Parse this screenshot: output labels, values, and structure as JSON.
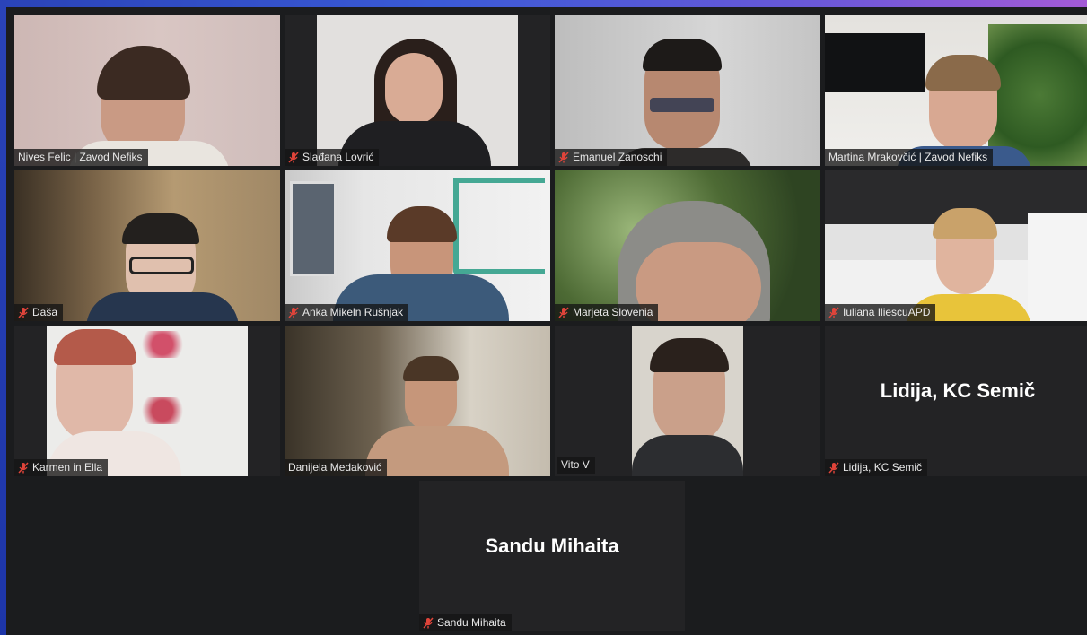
{
  "participants": [
    {
      "name": "Nives Felic | Zavod Nefiks",
      "muted": false
    },
    {
      "name": "Slađana Lovrić",
      "muted": true
    },
    {
      "name": "Emanuel Zanoschi",
      "muted": true
    },
    {
      "name": "Martina Mrakovčić | Zavod Nefiks",
      "muted": false
    },
    {
      "name": "Daša",
      "muted": true
    },
    {
      "name": "Anka Mikeln Rušnjak",
      "muted": true
    },
    {
      "name": "Marjeta Slovenia",
      "muted": true
    },
    {
      "name": "Iuliana IliescuAPD",
      "muted": true
    },
    {
      "name": "Karmen in Ella",
      "muted": true
    },
    {
      "name": "Danijela Medaković",
      "muted": false
    },
    {
      "name": "Vito V",
      "muted": false,
      "active_speaker": true
    },
    {
      "name": "Lidija, KC Semič",
      "muted": true,
      "video_off": true,
      "display_name": "Lidija, KC Semič"
    },
    {
      "name": "Sandu Mihaita",
      "muted": true,
      "video_off": true,
      "display_name": "Sandu Mihaita"
    }
  ],
  "colors": {
    "background": "#1b1c1e",
    "tile": "#232325",
    "active_speaker_border": "#c6e36a",
    "muted_icon": "#e0443a"
  },
  "icons": {
    "muted": "mic-muted-icon"
  }
}
